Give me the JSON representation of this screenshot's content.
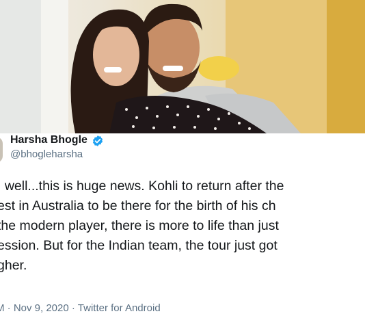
{
  "profile": {
    "name": "Harsha Bhogle",
    "handle": "@bhogleharsha",
    "verified_icon": "verified-badge-icon"
  },
  "tweet": {
    "lines": [
      ", well...this is huge news. Kohli to return after the",
      "est in Australia to be there for the birth of his ch",
      "the modern player, there is more to life than just",
      "ession. But for the Indian team, the tour just got",
      "gher."
    ]
  },
  "meta": {
    "text": "M · Nov 9, 2020 · Twitter for Android"
  },
  "colors": {
    "text": "#14171a",
    "secondary": "#5b7083",
    "verified": "#1da1f2"
  }
}
